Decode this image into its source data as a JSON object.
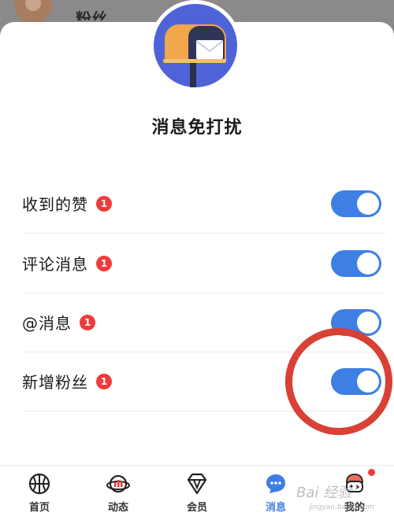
{
  "background": {
    "partial_name": "粉丝"
  },
  "sheet": {
    "title": "消息免打扰",
    "settings": [
      {
        "label": "收到的赞",
        "badge": "1",
        "enabled": true
      },
      {
        "label": "评论消息",
        "badge": "1",
        "enabled": true
      },
      {
        "label": "@消息",
        "badge": "1",
        "enabled": true
      },
      {
        "label": "新增粉丝",
        "badge": "1",
        "enabled": true
      }
    ]
  },
  "tabbar": {
    "active": "消息",
    "items": [
      {
        "label": "首页",
        "icon": "basketball-icon"
      },
      {
        "label": "动态",
        "icon": "planet-chart-icon"
      },
      {
        "label": "会员",
        "icon": "diamond-icon"
      },
      {
        "label": "消息",
        "icon": "chat-bubble-icon"
      },
      {
        "label": "我的",
        "icon": "mascot-face-icon"
      }
    ]
  },
  "colors": {
    "accent": "#3e7fe4",
    "badge": "#ef3b3b",
    "highlight": "#d94036"
  },
  "watermark": {
    "text": "Bai 经验",
    "sub": "jingyan.baidu.com"
  }
}
